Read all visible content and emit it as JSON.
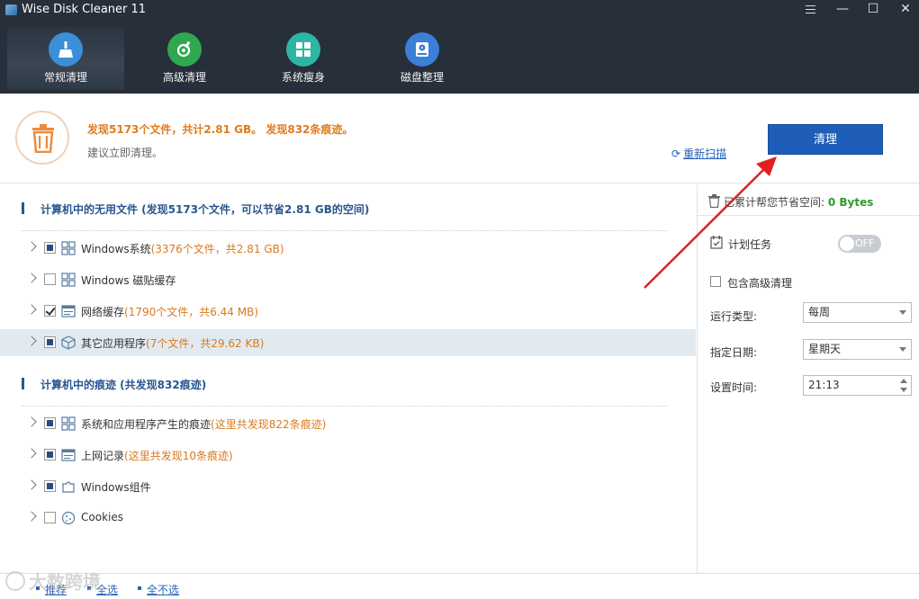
{
  "window": {
    "title": "Wise Disk Cleaner 11"
  },
  "nav": {
    "tabs": [
      {
        "label": "常规清理",
        "icon": "broom-icon",
        "color": "#3b8fd8"
      },
      {
        "label": "高级清理",
        "icon": "advanced-clean-icon",
        "color": "#2fa84f"
      },
      {
        "label": "系统瘦身",
        "icon": "windows-icon",
        "color": "#2db6a3"
      },
      {
        "label": "磁盘整理",
        "icon": "disk-defrag-icon",
        "color": "#3b7fd8"
      }
    ]
  },
  "summary": {
    "found": "发现5173个文件，共计2.81 GB。 发现832条痕迹。",
    "suggest": "建议立即清理。",
    "rescan": "重新扫描",
    "clean_button": "清理"
  },
  "sections": [
    {
      "title": "计算机中的无用文件 (发现5173个文件，可以节省2.81 GB的空间)",
      "items": [
        {
          "label": "Windows系统",
          "detail": "(3376个文件，共2.81 GB)",
          "check": "partial",
          "icon": "windows-grid-icon"
        },
        {
          "label": "Windows 磁贴缓存",
          "detail": "",
          "check": "unchecked",
          "icon": "windows-grid-icon"
        },
        {
          "label": "网络缓存",
          "detail": "(1790个文件，共6.44 MB)",
          "check": "checked",
          "icon": "browser-icon"
        },
        {
          "label": "其它应用程序",
          "detail": "(7个文件，共29.62 KB)",
          "check": "partial",
          "icon": "package-icon"
        }
      ]
    },
    {
      "title": "计算机中的痕迹 (共发现832痕迹)",
      "items": [
        {
          "label": "系统和应用程序产生的痕迹",
          "detail": "(这里共发现822条痕迹)",
          "check": "partial",
          "icon": "windows-grid-icon"
        },
        {
          "label": "上网记录",
          "detail": "(这里共发现10条痕迹)",
          "check": "partial",
          "icon": "browser-icon"
        },
        {
          "label": "Windows组件",
          "detail": "",
          "check": "partial",
          "icon": "puzzle-icon"
        },
        {
          "label": "Cookies",
          "detail": "",
          "check": "unchecked",
          "icon": "cookie-icon"
        }
      ]
    }
  ],
  "right": {
    "saved_label": "已累计帮您节省空间:",
    "saved_value": "0 Bytes",
    "schedule_label": "计划任务",
    "toggle_text": "OFF",
    "include_advanced": "包含高级清理",
    "run_type_label": "运行类型:",
    "run_type_value": "每周",
    "date_label": "指定日期:",
    "date_value": "星期天",
    "time_label": "设置时间:",
    "time_value": "21:13"
  },
  "footer": {
    "recommend": "推荐",
    "select_all": "全选",
    "select_none": "全不选"
  },
  "watermark": "大数跨境"
}
